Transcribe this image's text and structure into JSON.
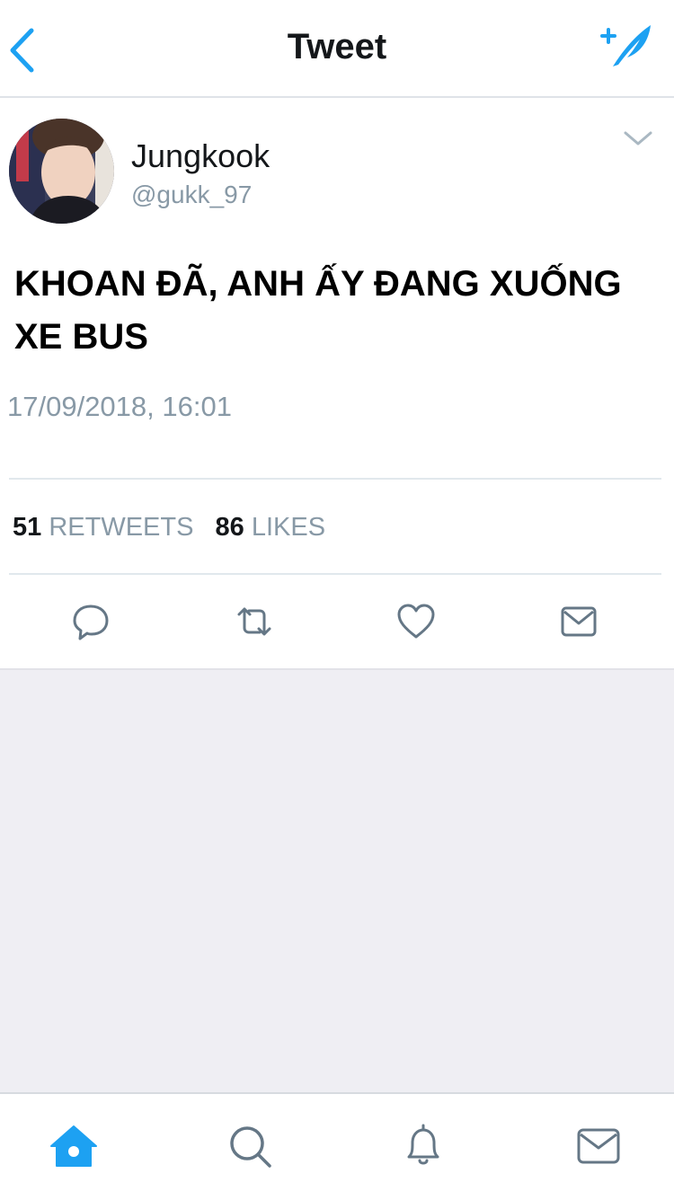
{
  "header": {
    "title": "Tweet",
    "back_icon": "chevron-left-icon",
    "compose_icon": "compose-tweet-icon"
  },
  "tweet": {
    "author": {
      "name": "Jungkook",
      "handle": "@gukk_97"
    },
    "text_line1": "KHOAN ĐÃ, ANH ẤY ĐANG XUỐNG",
    "text_line2": "XE BUS",
    "timestamp": "17/09/2018, 16:01",
    "retweets": {
      "count": "51",
      "label": "RETWEETS"
    },
    "likes": {
      "count": "86",
      "label": "LIKES"
    },
    "actions": [
      "reply-icon",
      "retweet-icon",
      "heart-icon",
      "message-icon"
    ]
  },
  "tabbar": {
    "tabs": [
      "home-icon",
      "search-icon",
      "notifications-icon",
      "messages-icon"
    ],
    "active": "home-icon"
  },
  "colors": {
    "accent": "#1da1f2",
    "icon_gray": "#657786",
    "secondary_text": "#8899a6",
    "empty_bg": "#efeef3"
  }
}
